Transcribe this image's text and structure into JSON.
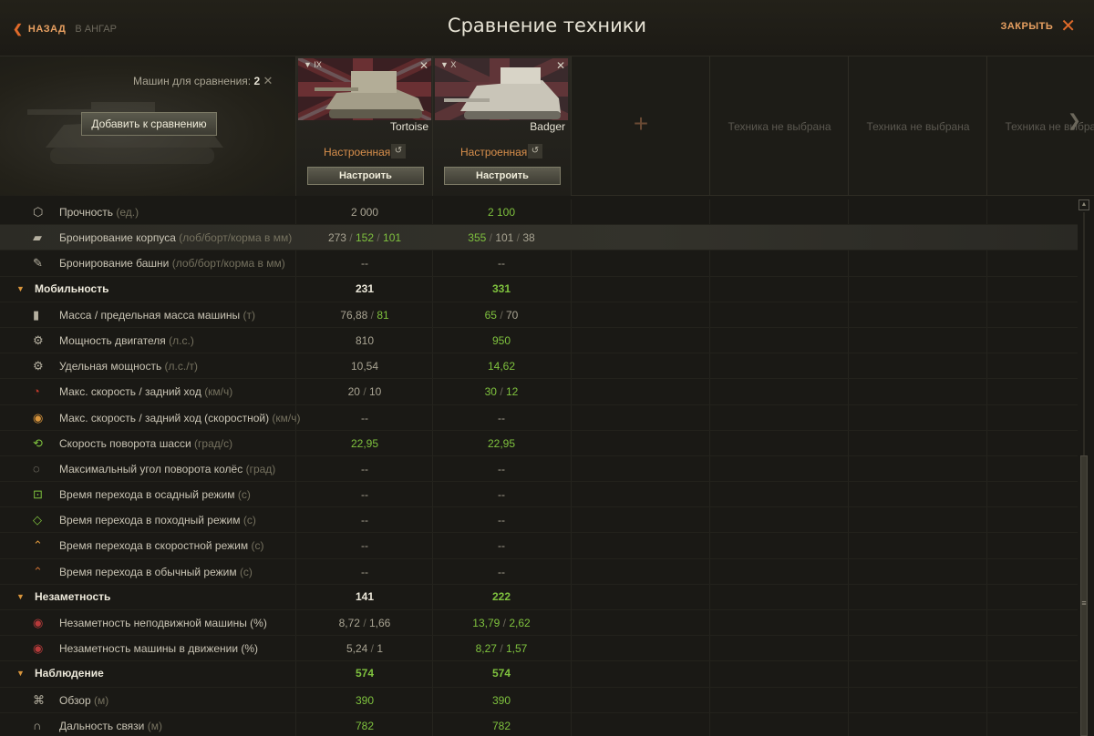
{
  "header": {
    "back_label": "НАЗАД",
    "back_sub": "В АНГАР",
    "title": "Сравнение техники",
    "close_label": "ЗАКРЫТЬ"
  },
  "compare": {
    "count_label": "Машин для сравнения:",
    "count_value": "2",
    "add_button": "Добавить к сравнению"
  },
  "vehicles": [
    {
      "tier": "IX",
      "name": "Tortoise",
      "state": "Настроенная",
      "configure": "Настроить"
    },
    {
      "tier": "X",
      "name": "Badger",
      "state": "Настроенная",
      "configure": "Настроить"
    }
  ],
  "empty_slots": [
    "Техника не выбрана",
    "Техника не выбрана",
    "Техника не выбрана"
  ],
  "colors": {
    "accent": "#e06a2a",
    "better": "#7fc23e",
    "state": "#d88f4c"
  },
  "rows": [
    {
      "type": "param",
      "icon": "hp-icon",
      "name": "Прочность",
      "unit": "(ед.)",
      "v1": "2 000",
      "v2": "2 100"
    },
    {
      "type": "param",
      "icon": "hull-armor-icon",
      "name": "Бронирование корпуса",
      "unit": "(лоб/борт/корма в мм)",
      "v1": [
        "273",
        "152",
        "101"
      ],
      "v2": [
        "355",
        "101",
        "38"
      ]
    },
    {
      "type": "param",
      "icon": "turret-armor-icon",
      "name": "Бронирование башни",
      "unit": "(лоб/борт/корма в мм)",
      "v1": "--",
      "v2": "--"
    },
    {
      "type": "category",
      "name": "Мобильность",
      "v1": "231",
      "v2": "331"
    },
    {
      "type": "param",
      "icon": "weight-icon",
      "name": "Масса / предельная масса машины",
      "unit": "(т)",
      "v1": [
        "76,88",
        "81"
      ],
      "v2": [
        "65",
        "70"
      ]
    },
    {
      "type": "param",
      "icon": "engine-icon",
      "name": "Мощность двигателя",
      "unit": "(л.с.)",
      "v1": "810",
      "v2": "950"
    },
    {
      "type": "param",
      "icon": "power-ratio-icon",
      "name": "Удельная мощность",
      "unit": "(л.с./т)",
      "v1": "10,54",
      "v2": "14,62"
    },
    {
      "type": "param",
      "icon": "speed-icon",
      "name": "Макс. скорость / задний ход",
      "unit": "(км/ч)",
      "v1": [
        "20",
        "10"
      ],
      "v2": [
        "30",
        "12"
      ]
    },
    {
      "type": "param",
      "icon": "speed-mode-icon",
      "name": "Макс. скорость / задний ход (скоростной)",
      "unit": "(км/ч)",
      "v1": "--",
      "v2": "--"
    },
    {
      "type": "param",
      "icon": "traverse-icon",
      "name": "Скорость поворота шасси",
      "unit": "(град/с)",
      "v1": "22,95",
      "v2": "22,95"
    },
    {
      "type": "param",
      "icon": "wheel-angle-icon",
      "name": "Максимальный угол поворота колёс",
      "unit": "(град)",
      "v1": "--",
      "v2": "--"
    },
    {
      "type": "param",
      "icon": "siege-mode-icon",
      "name": "Время перехода в осадный режим",
      "unit": "(с)",
      "v1": "--",
      "v2": "--"
    },
    {
      "type": "param",
      "icon": "travel-mode-icon",
      "name": "Время перехода в походный режим",
      "unit": " (с)",
      "v1": "--",
      "v2": "--"
    },
    {
      "type": "param",
      "icon": "fast-mode-icon",
      "name": "Время перехода в скоростной режим",
      "unit": "(с)",
      "v1": "--",
      "v2": "--"
    },
    {
      "type": "param",
      "icon": "normal-mode-icon",
      "name": "Время перехода в обычный режим",
      "unit": "(с)",
      "v1": "--",
      "v2": "--"
    },
    {
      "type": "category",
      "name": "Незаметность",
      "v1": "141",
      "v2": "222"
    },
    {
      "type": "param",
      "icon": "camo-stationary-icon",
      "name": "Незаметность неподвижной машины (%)",
      "unit": "",
      "v1": [
        "8,72",
        "1,66"
      ],
      "v2": [
        "13,79",
        "2,62"
      ]
    },
    {
      "type": "param",
      "icon": "camo-moving-icon",
      "name": "Незаметность машины в движении (%)",
      "unit": "",
      "v1": [
        "5,24",
        "1"
      ],
      "v2": [
        "8,27",
        "1,57"
      ]
    },
    {
      "type": "category",
      "name": "Наблюдение",
      "v1": "574",
      "v2": "574"
    },
    {
      "type": "param",
      "icon": "view-range-icon",
      "name": "Обзор",
      "unit": "(м)",
      "v1": "390",
      "v2": "390"
    },
    {
      "type": "param",
      "icon": "radio-range-icon",
      "name": "Дальность связи",
      "unit": "(м)",
      "v1": "782",
      "v2": "782"
    }
  ]
}
